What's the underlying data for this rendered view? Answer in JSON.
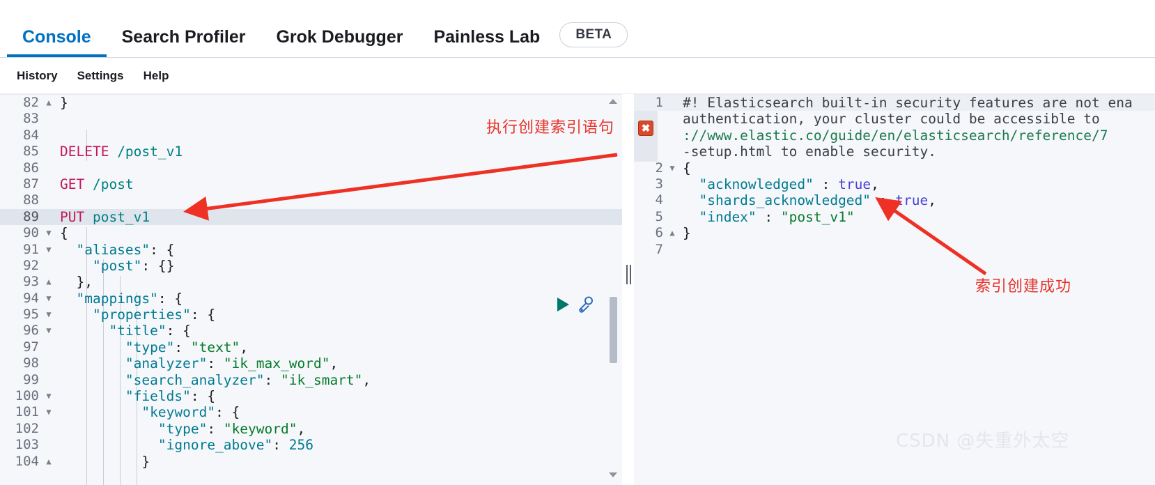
{
  "tabs": [
    {
      "label": "Console",
      "active": true
    },
    {
      "label": "Search Profiler",
      "active": false
    },
    {
      "label": "Grok Debugger",
      "active": false
    },
    {
      "label": "Painless Lab",
      "active": false
    }
  ],
  "beta_badge": "BETA",
  "subnav": [
    {
      "label": "History"
    },
    {
      "label": "Settings"
    },
    {
      "label": "Help"
    }
  ],
  "editor": {
    "active_line": 89,
    "run_tooltip": "Click to send request",
    "wrench_tooltip": "Open documentation",
    "lines": [
      {
        "num": "82",
        "fold": "▲",
        "tokens": [
          {
            "t": "}",
            "c": "k-punc"
          }
        ]
      },
      {
        "num": "83",
        "fold": "",
        "tokens": []
      },
      {
        "num": "84",
        "fold": "",
        "tokens": []
      },
      {
        "num": "85",
        "fold": "",
        "tokens": [
          {
            "t": "DELETE ",
            "c": "k-method"
          },
          {
            "t": "/post_v1",
            "c": "k-url"
          }
        ]
      },
      {
        "num": "86",
        "fold": "",
        "tokens": []
      },
      {
        "num": "87",
        "fold": "",
        "tokens": [
          {
            "t": "GET ",
            "c": "k-method"
          },
          {
            "t": "/post",
            "c": "k-url"
          }
        ]
      },
      {
        "num": "88",
        "fold": "",
        "tokens": []
      },
      {
        "num": "89",
        "fold": "",
        "tokens": [
          {
            "t": "PUT ",
            "c": "k-method"
          },
          {
            "t": "post_v1",
            "c": "k-url"
          }
        ]
      },
      {
        "num": "90",
        "fold": "▼",
        "tokens": [
          {
            "t": "{",
            "c": "k-punc"
          }
        ]
      },
      {
        "num": "91",
        "fold": "▼",
        "tokens": [
          {
            "t": "  ",
            "c": "k-punc"
          },
          {
            "t": "\"aliases\"",
            "c": "k-key"
          },
          {
            "t": ": {",
            "c": "k-punc"
          }
        ]
      },
      {
        "num": "92",
        "fold": "",
        "tokens": [
          {
            "t": "    ",
            "c": "k-punc"
          },
          {
            "t": "\"post\"",
            "c": "k-key"
          },
          {
            "t": ": {}",
            "c": "k-punc"
          }
        ]
      },
      {
        "num": "93",
        "fold": "▲",
        "tokens": [
          {
            "t": "  },",
            "c": "k-punc"
          }
        ]
      },
      {
        "num": "94",
        "fold": "▼",
        "tokens": [
          {
            "t": "  ",
            "c": "k-punc"
          },
          {
            "t": "\"mappings\"",
            "c": "k-key"
          },
          {
            "t": ": {",
            "c": "k-punc"
          }
        ]
      },
      {
        "num": "95",
        "fold": "▼",
        "tokens": [
          {
            "t": "    ",
            "c": "k-punc"
          },
          {
            "t": "\"properties\"",
            "c": "k-key"
          },
          {
            "t": ": {",
            "c": "k-punc"
          }
        ]
      },
      {
        "num": "96",
        "fold": "▼",
        "tokens": [
          {
            "t": "      ",
            "c": "k-punc"
          },
          {
            "t": "\"title\"",
            "c": "k-key"
          },
          {
            "t": ": {",
            "c": "k-punc"
          }
        ]
      },
      {
        "num": "97",
        "fold": "",
        "tokens": [
          {
            "t": "        ",
            "c": "k-punc"
          },
          {
            "t": "\"type\"",
            "c": "k-key"
          },
          {
            "t": ": ",
            "c": "k-punc"
          },
          {
            "t": "\"text\"",
            "c": "k-str"
          },
          {
            "t": ",",
            "c": "k-punc"
          }
        ]
      },
      {
        "num": "98",
        "fold": "",
        "tokens": [
          {
            "t": "        ",
            "c": "k-punc"
          },
          {
            "t": "\"analyzer\"",
            "c": "k-key"
          },
          {
            "t": ": ",
            "c": "k-punc"
          },
          {
            "t": "\"ik_max_word\"",
            "c": "k-str"
          },
          {
            "t": ",",
            "c": "k-punc"
          }
        ]
      },
      {
        "num": "99",
        "fold": "",
        "tokens": [
          {
            "t": "        ",
            "c": "k-punc"
          },
          {
            "t": "\"search_analyzer\"",
            "c": "k-key"
          },
          {
            "t": ": ",
            "c": "k-punc"
          },
          {
            "t": "\"ik_smart\"",
            "c": "k-str"
          },
          {
            "t": ",",
            "c": "k-punc"
          }
        ]
      },
      {
        "num": "100",
        "fold": "▼",
        "tokens": [
          {
            "t": "        ",
            "c": "k-punc"
          },
          {
            "t": "\"fields\"",
            "c": "k-key"
          },
          {
            "t": ": {",
            "c": "k-punc"
          }
        ]
      },
      {
        "num": "101",
        "fold": "▼",
        "tokens": [
          {
            "t": "          ",
            "c": "k-punc"
          },
          {
            "t": "\"keyword\"",
            "c": "k-key"
          },
          {
            "t": ": {",
            "c": "k-punc"
          }
        ]
      },
      {
        "num": "102",
        "fold": "",
        "tokens": [
          {
            "t": "            ",
            "c": "k-punc"
          },
          {
            "t": "\"type\"",
            "c": "k-key"
          },
          {
            "t": ": ",
            "c": "k-punc"
          },
          {
            "t": "\"keyword\"",
            "c": "k-str"
          },
          {
            "t": ",",
            "c": "k-punc"
          }
        ]
      },
      {
        "num": "103",
        "fold": "",
        "tokens": [
          {
            "t": "            ",
            "c": "k-punc"
          },
          {
            "t": "\"ignore_above\"",
            "c": "k-key"
          },
          {
            "t": ": ",
            "c": "k-punc"
          },
          {
            "t": "256",
            "c": "k-num"
          }
        ]
      },
      {
        "num": "104",
        "fold": "▲",
        "tokens": [
          {
            "t": "          }",
            "c": "k-punc"
          }
        ]
      }
    ]
  },
  "response": {
    "error_badge": "✖",
    "lines": [
      {
        "num": "1",
        "fold": "",
        "warn": true,
        "tokens": [
          {
            "t": "#! Elasticsearch built-in security features are not ena",
            "c": "k-warn"
          }
        ]
      },
      {
        "num": "",
        "fold": "",
        "warn": false,
        "tokens": [
          {
            "t": "authentication, your cluster could be accessible to ",
            "c": "k-warn"
          }
        ]
      },
      {
        "num": "",
        "fold": "",
        "warn": false,
        "tokens": [
          {
            "t": "://www.elastic.co/guide/en/elasticsearch/reference/7",
            "c": "k-link"
          }
        ]
      },
      {
        "num": "",
        "fold": "",
        "warn": false,
        "tokens": [
          {
            "t": "-setup.html to enable security.",
            "c": "k-warn"
          }
        ]
      },
      {
        "num": "2",
        "fold": "▼",
        "warn": false,
        "tokens": [
          {
            "t": "{",
            "c": "k-punc"
          }
        ]
      },
      {
        "num": "3",
        "fold": "",
        "warn": false,
        "tokens": [
          {
            "t": "  ",
            "c": "k-punc"
          },
          {
            "t": "\"acknowledged\"",
            "c": "k-key"
          },
          {
            "t": " : ",
            "c": "k-punc"
          },
          {
            "t": "true",
            "c": "k-bool"
          },
          {
            "t": ",",
            "c": "k-punc"
          }
        ]
      },
      {
        "num": "4",
        "fold": "",
        "warn": false,
        "tokens": [
          {
            "t": "  ",
            "c": "k-punc"
          },
          {
            "t": "\"shards_acknowledged\"",
            "c": "k-key"
          },
          {
            "t": " : ",
            "c": "k-punc"
          },
          {
            "t": "true",
            "c": "k-bool"
          },
          {
            "t": ",",
            "c": "k-punc"
          }
        ]
      },
      {
        "num": "5",
        "fold": "",
        "warn": false,
        "tokens": [
          {
            "t": "  ",
            "c": "k-punc"
          },
          {
            "t": "\"index\"",
            "c": "k-key"
          },
          {
            "t": " : ",
            "c": "k-punc"
          },
          {
            "t": "\"post_v1\"",
            "c": "k-str"
          }
        ]
      },
      {
        "num": "6",
        "fold": "▲",
        "warn": false,
        "tokens": [
          {
            "t": "}",
            "c": "k-punc"
          }
        ]
      },
      {
        "num": "7",
        "fold": "",
        "warn": false,
        "tokens": []
      }
    ]
  },
  "annotations": {
    "execute_create_index": "执行创建索引语句",
    "index_created_success": "索引创建成功",
    "accent_color": "#e8322a"
  },
  "watermark": "CSDN @失重外太空"
}
